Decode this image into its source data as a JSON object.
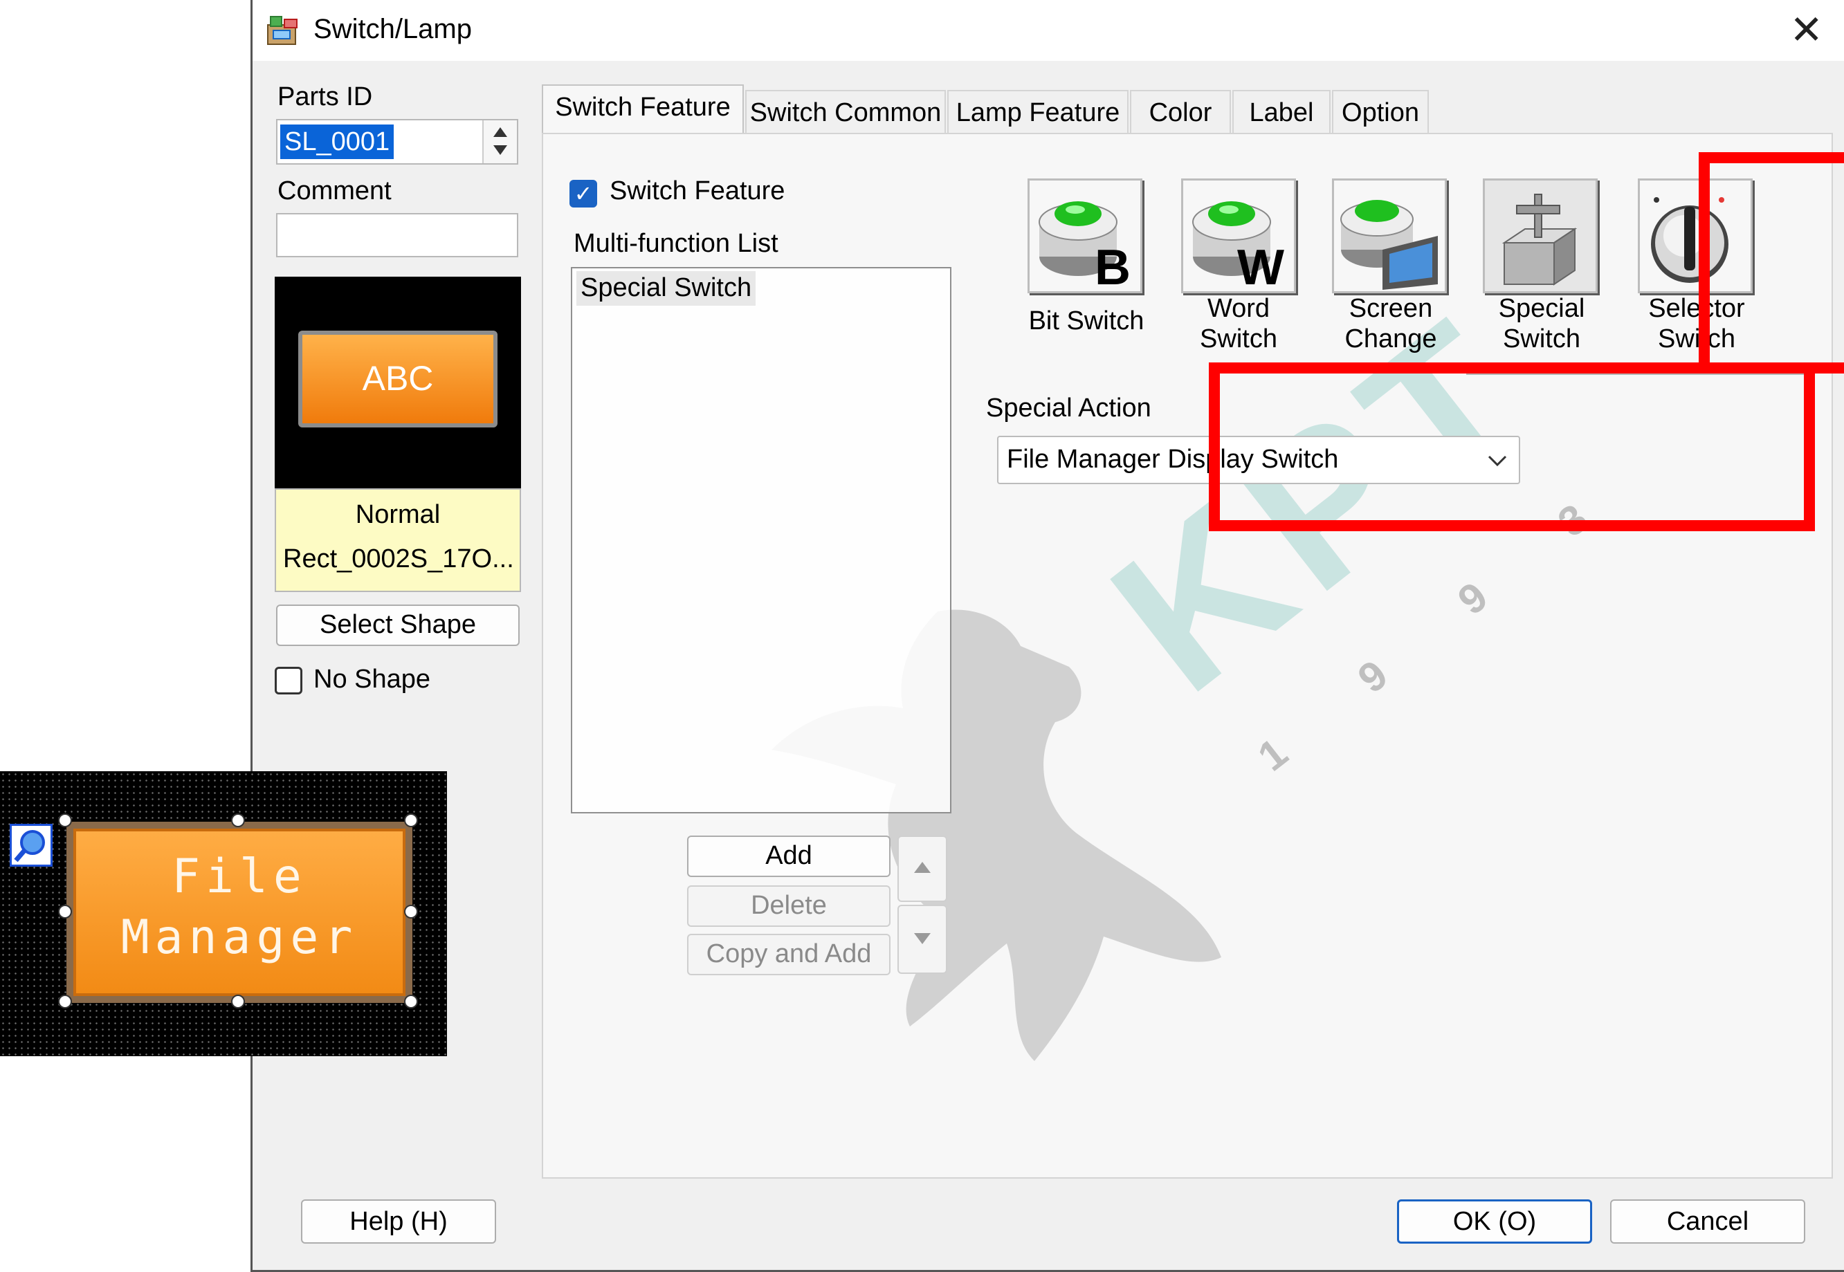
{
  "window": {
    "title": "Switch/Lamp",
    "close_glyph": "✕"
  },
  "left_panel": {
    "parts_id_label": "Parts ID",
    "parts_id_value": "SL_0001",
    "comment_label": "Comment",
    "comment_value": "",
    "preview_text": "ABC",
    "preview_state": "Normal",
    "preview_shape": "Rect_0002S_17O...",
    "select_shape_label": "Select Shape",
    "no_shape_label": "No Shape",
    "no_shape_checked": false
  },
  "tabs": [
    "Switch Feature",
    "Switch Common",
    "Lamp Feature",
    "Color",
    "Label",
    "Option"
  ],
  "active_tab": "Switch Feature",
  "switch_feature": {
    "enable_label": "Switch Feature",
    "enabled": true,
    "list_label": "Multi-function List",
    "list_items": [
      "Special Switch"
    ],
    "add_label": "Add",
    "delete_label": "Delete",
    "copy_add_label": "Copy and Add"
  },
  "switch_types": [
    {
      "line1": "Bit Switch",
      "line2": "",
      "icon": "bit-switch-icon"
    },
    {
      "line1": "Word",
      "line2": "Switch",
      "icon": "word-switch-icon"
    },
    {
      "line1": "Screen",
      "line2": "Change",
      "icon": "screen-change-icon"
    },
    {
      "line1": "Special",
      "line2": "Switch",
      "icon": "special-switch-icon"
    },
    {
      "line1": "Selector",
      "line2": "Switch",
      "icon": "selector-switch-icon"
    }
  ],
  "selected_switch_type": "Special Switch",
  "special_action": {
    "label": "Special Action",
    "value": "File Manager Display Switch"
  },
  "footer": {
    "help_label": "Help (H)",
    "ok_label": "OK (O)",
    "cancel_label": "Cancel"
  },
  "canvas_part": {
    "line1": "File",
    "line2": "Manager"
  },
  "watermark": {
    "text": "KPT",
    "year": "1993"
  },
  "colors": {
    "highlight": "#ff0000",
    "part_orange": "#f7941d",
    "selection_blue": "#0a64d8",
    "watermark_teal": "#b8dcd9"
  }
}
